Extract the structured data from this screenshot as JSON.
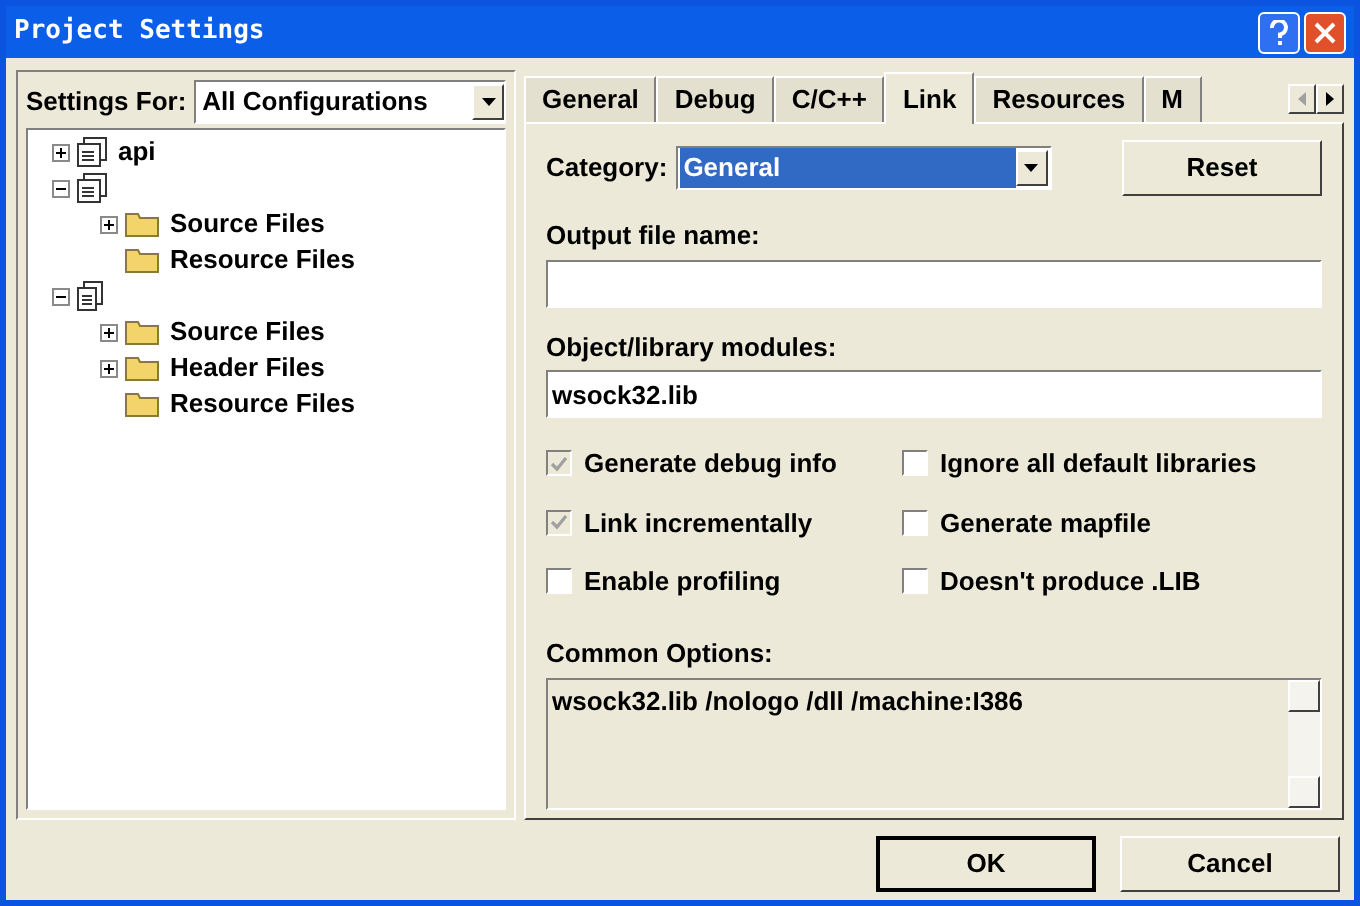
{
  "window": {
    "title": "Project Settings"
  },
  "settings_for": {
    "label": "Settings For:",
    "value": "All Configurations"
  },
  "tree": [
    {
      "label": "api",
      "kind": "project",
      "expanded": false
    },
    {
      "kind": "project",
      "expanded": true,
      "children": [
        {
          "label": "Source Files",
          "kind": "folder",
          "expanded": false
        },
        {
          "label": "Resource Files",
          "kind": "folder"
        }
      ]
    },
    {
      "kind": "file",
      "expanded": true,
      "children": [
        {
          "label": "Source Files",
          "kind": "folder",
          "expanded": false
        },
        {
          "label": "Header Files",
          "kind": "folder",
          "expanded": false
        },
        {
          "label": "Resource Files",
          "kind": "folder"
        }
      ]
    }
  ],
  "tabs": [
    {
      "label": "General",
      "selected": false
    },
    {
      "label": "Debug",
      "selected": false
    },
    {
      "label": "C/C++",
      "selected": false
    },
    {
      "label": "Link",
      "selected": true
    },
    {
      "label": "Resources",
      "selected": false
    },
    {
      "label": "M",
      "selected": false
    }
  ],
  "category": {
    "label": "Category:",
    "value": "General"
  },
  "reset_button": "Reset",
  "output_file": {
    "label": "Output file name:"
  },
  "modules": {
    "label": "Object/library modules:",
    "value": "wsock32.lib"
  },
  "options": [
    {
      "label": "Generate debug info",
      "checked": true,
      "disabled": true
    },
    {
      "label": "Ignore all default libraries",
      "checked": false,
      "disabled": false
    },
    {
      "label": "Link incrementally",
      "checked": true,
      "disabled": true
    },
    {
      "label": "Generate mapfile",
      "checked": false,
      "disabled": false
    },
    {
      "label": "Enable profiling",
      "checked": false,
      "disabled": false
    },
    {
      "label": "Doesn't produce .LIB",
      "checked": false,
      "disabled": false
    }
  ],
  "common_options": {
    "label": "Common Options:",
    "value": "wsock32.lib /nologo /dll /machine:I386"
  },
  "buttons": [
    "OK",
    "Cancel"
  ]
}
